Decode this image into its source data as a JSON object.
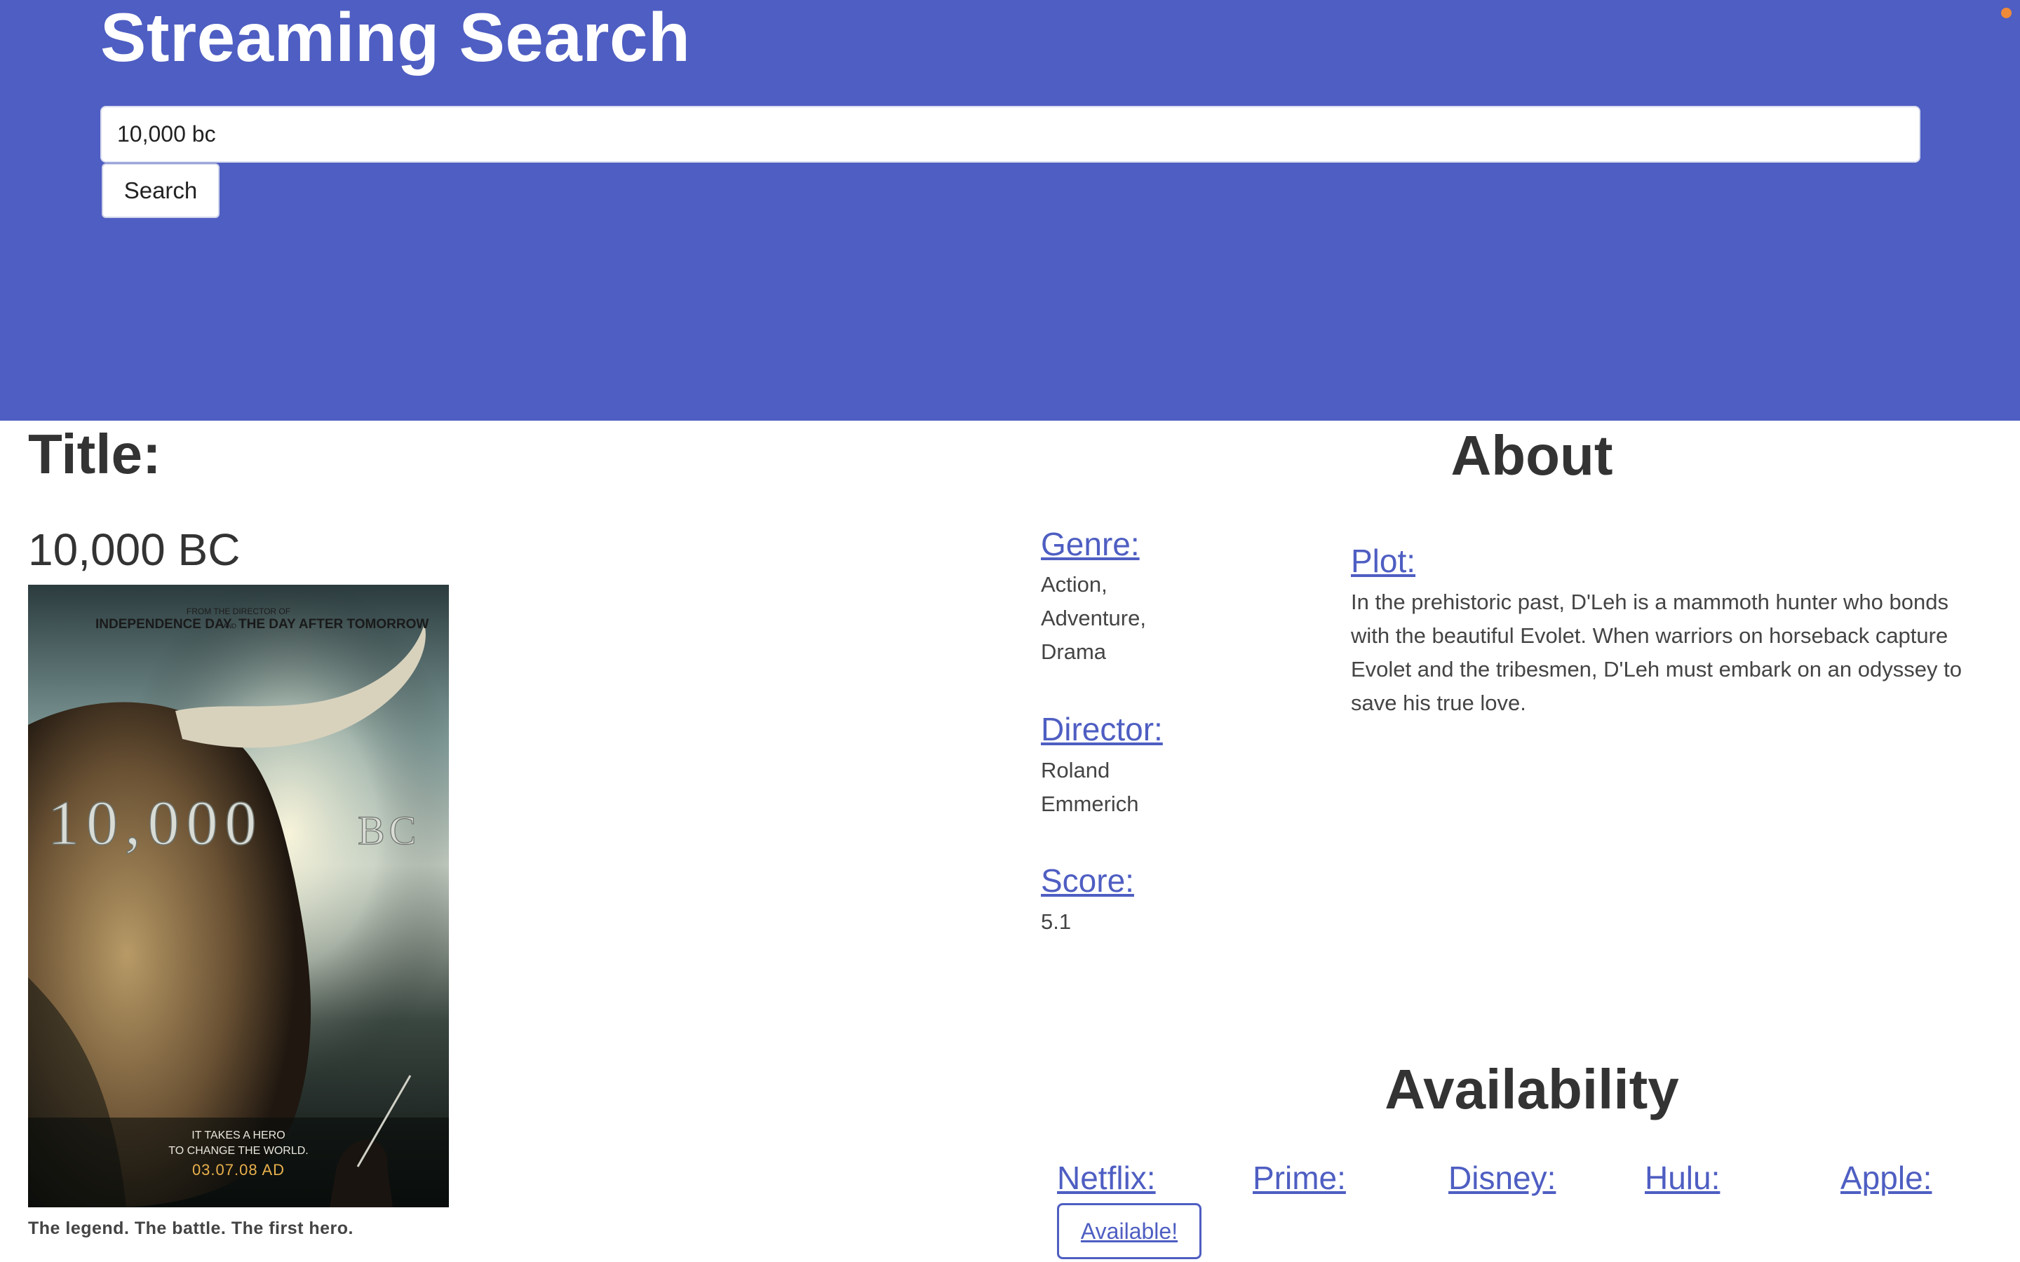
{
  "header": {
    "app_title": "Streaming Search",
    "search_value": "10,000 bc",
    "search_button": "Search",
    "background_color": "#4e5ec2"
  },
  "title_section": {
    "heading": "Title:",
    "movie_title": "10,000 BC",
    "poster": {
      "top_line_small": "FROM THE DIRECTOR OF",
      "top_line": "INDEPENDENCE DAY",
      "top_and": "AND",
      "top_line_2": "THE DAY AFTER TOMORROW",
      "logo_text": "10,000",
      "logo_suffix": "BC",
      "tag_1": "IT TAKES A HERO",
      "tag_2": "TO CHANGE THE WORLD.",
      "date": "03.07.08 AD"
    },
    "tagline": "The legend. The battle. The first hero."
  },
  "about": {
    "heading": "About",
    "genre_label": "Genre:",
    "genre_lines": [
      "Action,",
      "Adventure,",
      "Drama"
    ],
    "director_label": "Director:",
    "director_lines": [
      "Roland",
      "Emmerich"
    ],
    "score_label": "Score:",
    "score": "5.1",
    "plot_label": "Plot:",
    "plot_lines": [
      "In the prehistoric past, D'Leh is a mammoth hunter who bonds",
      "with the beautiful Evolet. When warriors on horseback capture",
      "Evolet and the tribesmen, D'Leh must embark on an odyssey to",
      "save his true love."
    ]
  },
  "availability": {
    "heading": "Availability",
    "services": [
      "Netflix:",
      "Prime:",
      "Disney:",
      "Hulu:",
      "Apple:"
    ],
    "netflix_status": "Available!"
  }
}
